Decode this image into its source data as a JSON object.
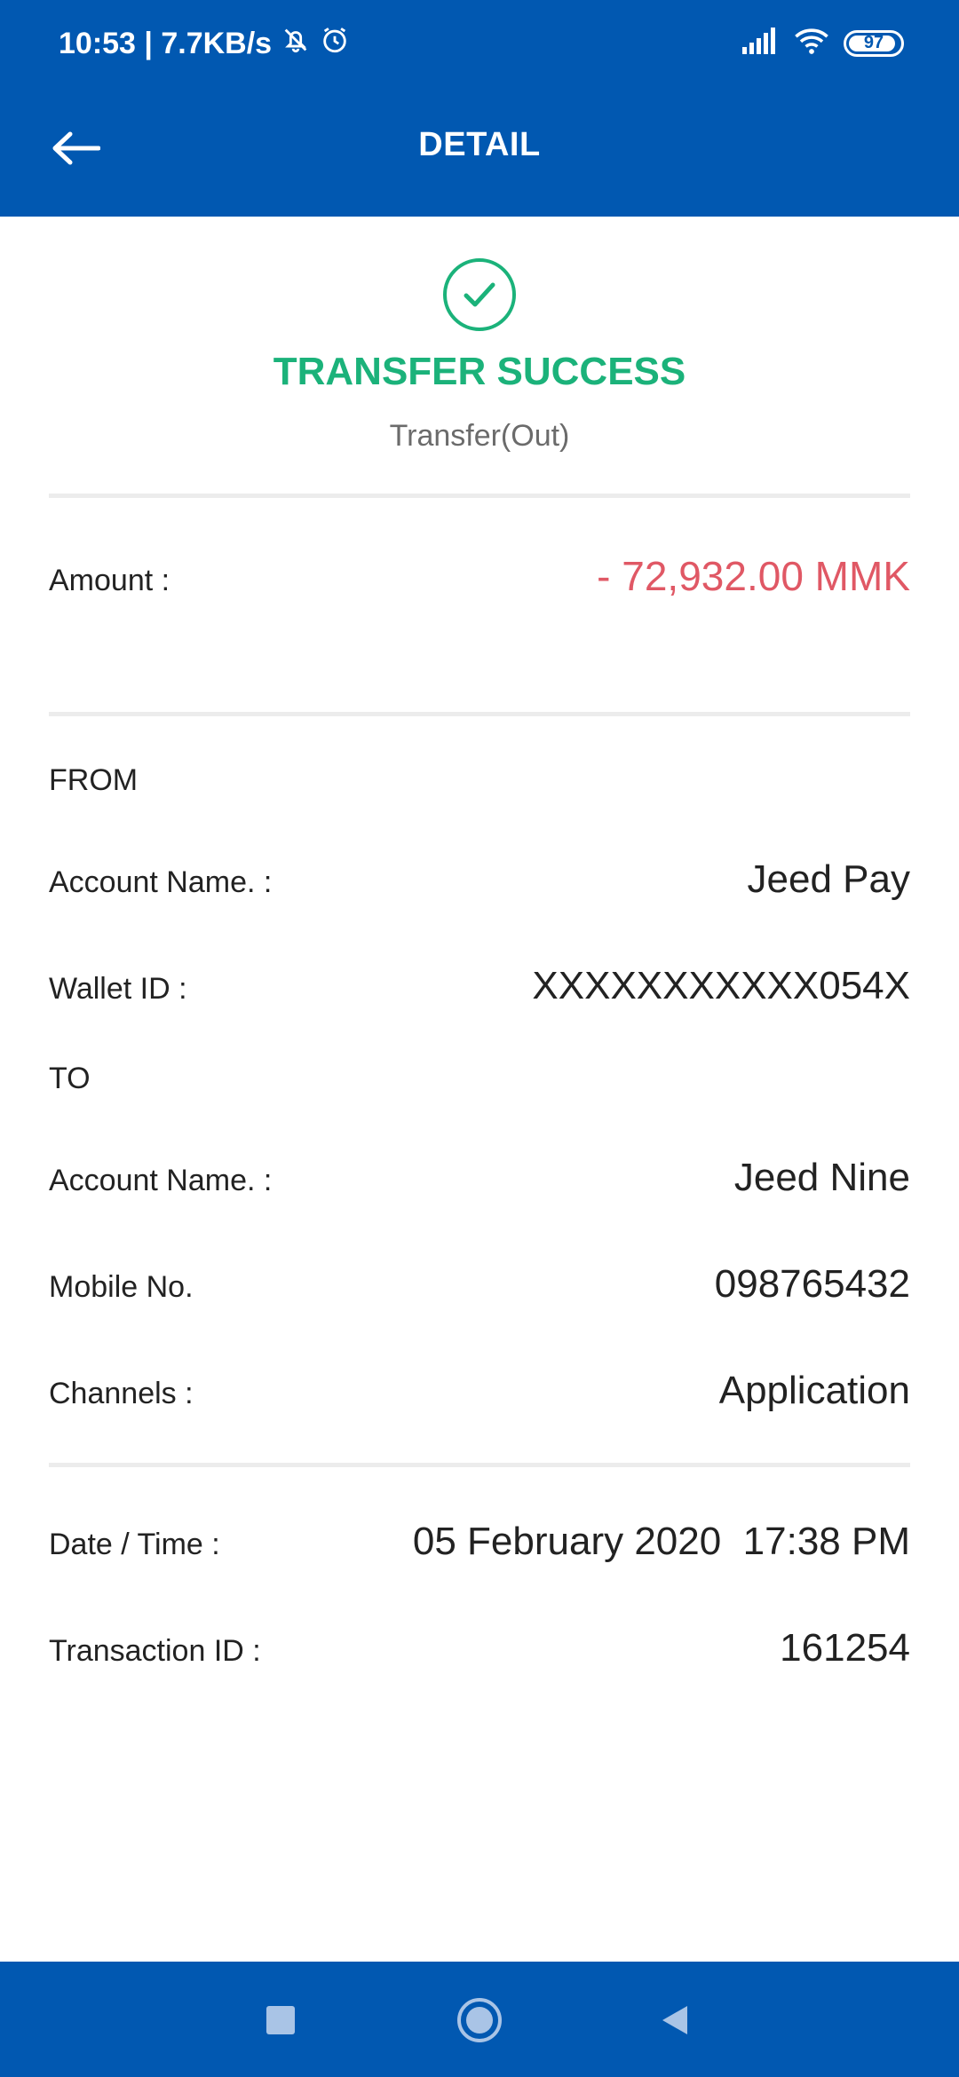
{
  "status_bar": {
    "time_speed": "10:53 | 7.7KB/s",
    "battery": "97"
  },
  "header": {
    "title": "DETAIL"
  },
  "result": {
    "title": "TRANSFER SUCCESS",
    "subtitle": "Transfer(Out)",
    "color": "#1bb27a"
  },
  "amount": {
    "label": "Amount :",
    "value": "- 72,932.00 MMK",
    "color": "#e05865"
  },
  "from": {
    "heading": "FROM",
    "account_name_label": "Account Name. :",
    "account_name": "Jeed Pay",
    "wallet_id_label": "Wallet ID :",
    "wallet_id": "XXXXXXXXXXX054X"
  },
  "to": {
    "heading": "TO",
    "account_name_label": "Account Name. :",
    "account_name": "Jeed Nine",
    "mobile_label": "Mobile No.",
    "mobile": "098765432",
    "channels_label": "Channels :",
    "channels": "Application"
  },
  "meta": {
    "datetime_label": "Date / Time :",
    "datetime": "05 February 2020  17:38 PM",
    "transaction_id_label": "Transaction ID :",
    "transaction_id": "161254"
  },
  "icons": {
    "back": "back-arrow-icon",
    "success": "check-circle-icon",
    "nav_recents": "square-icon",
    "nav_home": "circle-icon",
    "nav_back": "triangle-back-icon"
  },
  "colors": {
    "primary": "#0158b1"
  }
}
